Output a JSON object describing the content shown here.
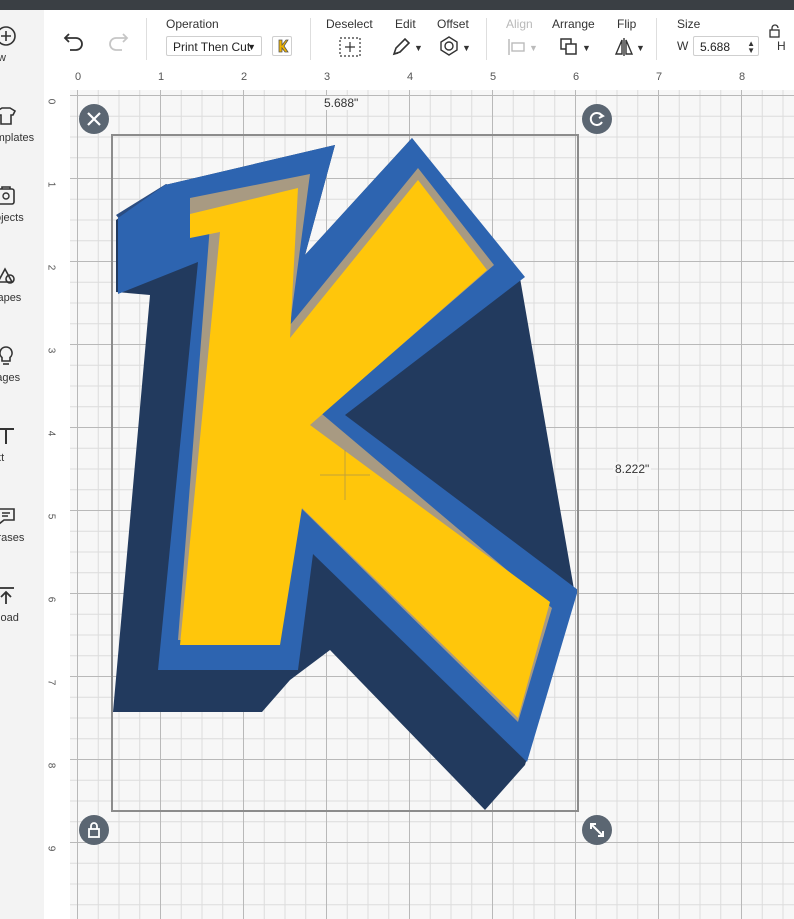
{
  "sidebar": {
    "items": [
      {
        "label": "New",
        "icon": "plus-circle-icon"
      },
      {
        "label": "Templates",
        "icon": "shirt-icon"
      },
      {
        "label": "Projects",
        "icon": "projects-icon"
      },
      {
        "label": "Shapes",
        "icon": "shapes-icon"
      },
      {
        "label": "Images",
        "icon": "lightbulb-icon"
      },
      {
        "label": "Text",
        "icon": "text-icon"
      },
      {
        "label": "Phrases",
        "icon": "speech-bubble-icon"
      },
      {
        "label": "Upload",
        "icon": "upload-icon"
      }
    ]
  },
  "toolbar": {
    "operation_label": "Operation",
    "operation_value": "Print Then Cut",
    "deselect_label": "Deselect",
    "edit_label": "Edit",
    "offset_label": "Offset",
    "align_label": "Align",
    "arrange_label": "Arrange",
    "flip_label": "Flip",
    "size_label": "Size",
    "width_prefix": "W",
    "width_value": "5.688",
    "height_prefix": "H"
  },
  "ruler": {
    "top": [
      "0",
      "1",
      "2",
      "3",
      "4",
      "5",
      "6",
      "7",
      "8"
    ],
    "left": [
      "0",
      "1",
      "2",
      "3",
      "4",
      "5",
      "6",
      "7",
      "8",
      "9"
    ]
  },
  "canvas": {
    "width_dimension": "5.688\"",
    "height_dimension": "8.222\""
  },
  "colors": {
    "letter_fill": "#ffc60b",
    "letter_outline": "#2d64b0",
    "letter_shadow": "#223a5e",
    "letter_inner_shadow": "#a89a82"
  }
}
